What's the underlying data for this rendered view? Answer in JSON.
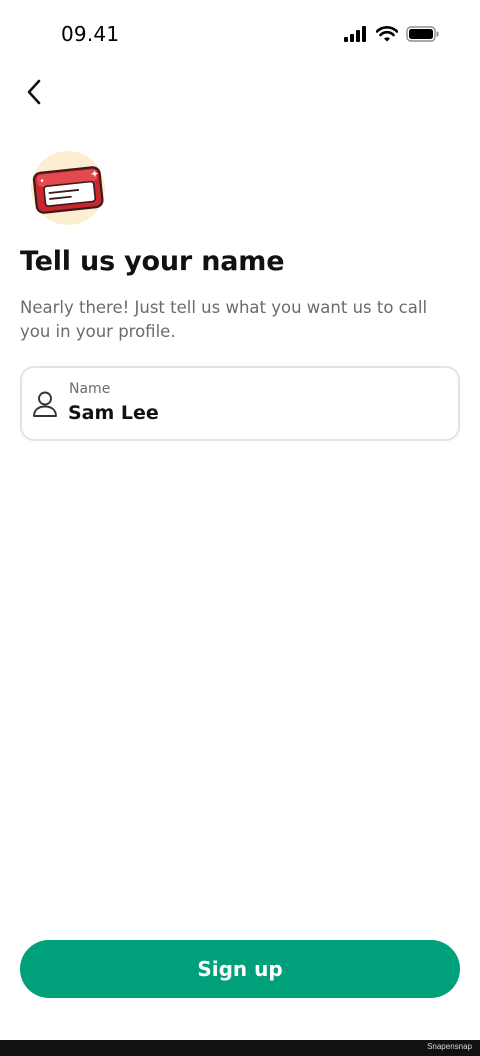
{
  "status_bar": {
    "time": "09.41",
    "icons": [
      "cellular-signal-icon",
      "wifi-icon",
      "battery-icon"
    ]
  },
  "navigation": {
    "back_icon": "chevron-left-icon"
  },
  "illustration": {
    "icon": "name-tag-card-icon"
  },
  "header": {
    "title": "Tell us your name",
    "subtitle": "Nearly there! Just tell us what you want us to call you in your profile."
  },
  "form": {
    "name_field": {
      "label": "Name",
      "value": "Sam Lee",
      "icon": "person-icon"
    }
  },
  "actions": {
    "signup_label": "Sign up"
  },
  "footer": {
    "watermark": "Snapensnap"
  },
  "colors": {
    "primary_button": "#00a07a",
    "card_red": "#d8353d",
    "illustration_bg": "#fdeed2"
  }
}
